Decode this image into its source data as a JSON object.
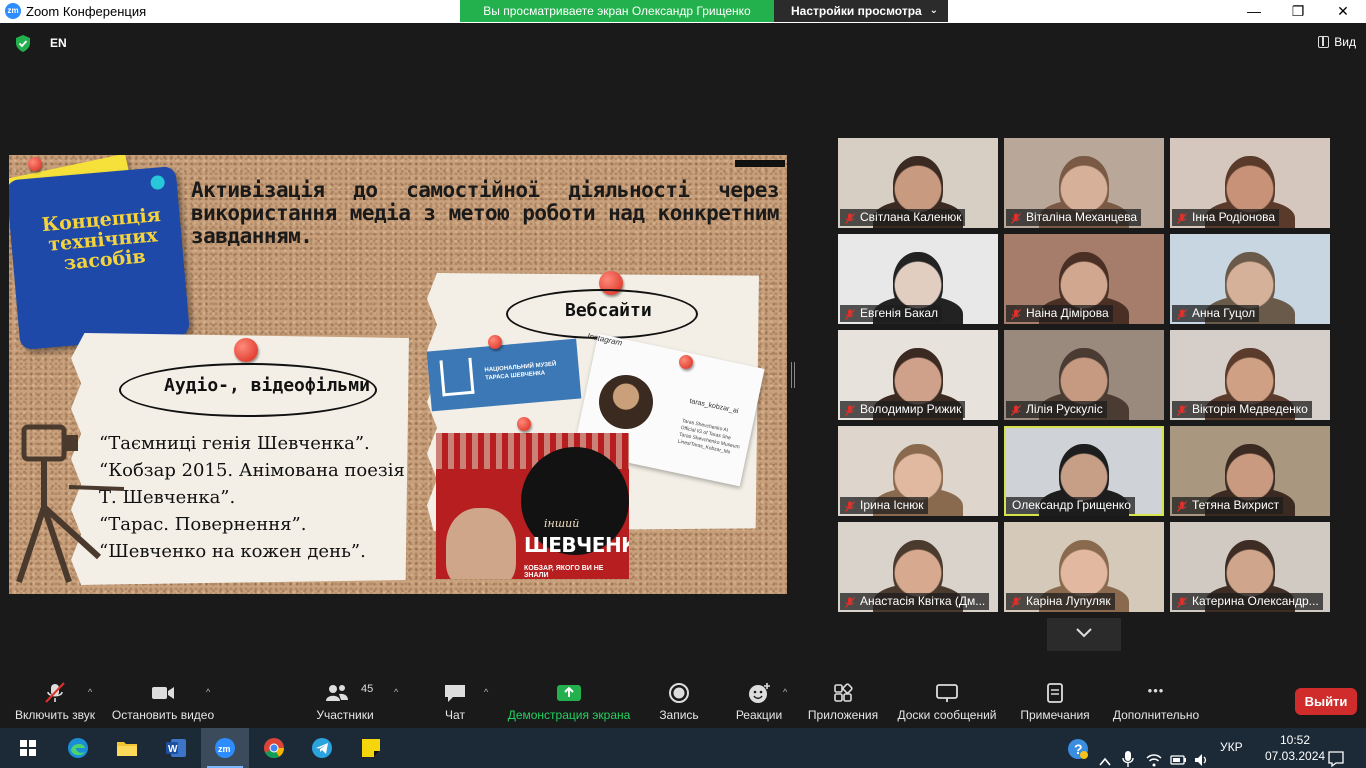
{
  "window": {
    "title": "Zoom Конференция",
    "logo_text": "zm",
    "minimize": "—",
    "maximize": "❐",
    "close": "✕"
  },
  "share_banner": {
    "text": "Вы просматриваете экран Олександр Грищенко",
    "view_settings": "Настройки просмотра",
    "view_settings_chevron": "⌄"
  },
  "meeting_bar": {
    "language": "EN",
    "view_label": "Вид"
  },
  "slide": {
    "card_title_lines": [
      "Концепція",
      "технічних",
      "засобів"
    ],
    "heading": "Активізація до самостійної діяльності через використання медіа з метою роботи над конкретним завданням.",
    "left_section_title": "Аудіо-, відеофільми",
    "films": [
      "“Таємниці генія Шевченка”.",
      "“Кобзар 2015. Анімована поезія",
      "Т. Шевченка”.",
      " “Тарас. Повернення”.",
      "“Шевченко на кожен день”."
    ],
    "right_section_title": "Вебсайти",
    "museum_text": "НАЦІОНАЛЬНИЙ МУЗЕЙ ТАРАСА ШЕВЧЕНКА",
    "instagram_label": "Instagram",
    "instagram_handle": "taras_kobzar_ai",
    "instagram_lines": [
      "Taras Shevchenko AI",
      "Official IG of Taras She",
      "Taras Shevchenko Museum",
      "Lines/Taras_Kobzar_Ms"
    ],
    "poster_small": "інший",
    "poster_big": "ШЕВЧЕНКО",
    "poster_sub": "КОБЗАР, ЯКОГО ВИ НЕ ЗНАЛИ"
  },
  "participants": [
    {
      "name": "Світлана Каленюк",
      "muted": true
    },
    {
      "name": "Віталіна Механцева",
      "muted": true
    },
    {
      "name": "Інна Родіонова",
      "muted": true
    },
    {
      "name": "Евгенія Бакал",
      "muted": true
    },
    {
      "name": "Наіна Дімірова",
      "muted": true
    },
    {
      "name": "Анна Гуцол",
      "muted": true
    },
    {
      "name": "Володимир Рижик",
      "muted": true
    },
    {
      "name": "Лілія Рускуліс",
      "muted": true
    },
    {
      "name": "Вікторія Медведенко",
      "muted": true
    },
    {
      "name": "Ірина Існюк",
      "muted": true
    },
    {
      "name": "Олександр Грищенко",
      "muted": false,
      "active": true
    },
    {
      "name": "Тетяна Вихрист",
      "muted": true
    },
    {
      "name": "Анастасія Квітка (Дм...",
      "muted": true
    },
    {
      "name": "Каріна Лупуляк",
      "muted": true
    },
    {
      "name": "Катерина Олександр...",
      "muted": true
    }
  ],
  "toolbar": {
    "unmute": "Включить звук",
    "stop_video": "Остановить видео",
    "participants": "Участники",
    "participants_count": "45",
    "chat": "Чат",
    "share_screen": "Демонстрация экрана",
    "record": "Запись",
    "reactions": "Реакции",
    "apps": "Приложения",
    "whiteboards": "Доски сообщений",
    "notes": "Примечания",
    "more": "Дополнительно",
    "leave": "Выйти",
    "caret": "^",
    "more_dots": "•••"
  },
  "taskbar": {
    "zoom_label": "zm",
    "word_label": "W",
    "language": "УКР",
    "time": "10:52",
    "date": "07.03.2024",
    "help": "?"
  },
  "colors": {
    "share_green": "#23b14d",
    "accent_blue": "#2d8cff",
    "leave_red": "#d12c2c",
    "active_speaker": "#d7e34a",
    "muted_red": "#e0302b"
  }
}
